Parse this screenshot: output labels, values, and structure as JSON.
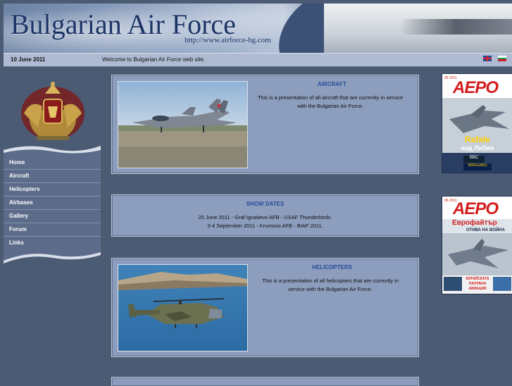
{
  "header": {
    "title": "Bulgarian Air Force",
    "url": "http://www.airforce-bg.com"
  },
  "datebar": {
    "date": "10 June 2011",
    "welcome": "Welcome to Bulgarian Air Force web site."
  },
  "flags": [
    {
      "icon": "uk-flag-icon"
    },
    {
      "icon": "bulgaria-flag-icon"
    }
  ],
  "nav": {
    "items": [
      {
        "label": "Home"
      },
      {
        "label": "Aircraft"
      },
      {
        "label": "Helicopters"
      },
      {
        "label": "Airbases"
      },
      {
        "label": "Gallery"
      },
      {
        "label": "Forum"
      },
      {
        "label": "Links"
      }
    ]
  },
  "panels": {
    "aircraft": {
      "title": "AIRCRAFT",
      "text_line1": "This is a presentation of all aircraft that are currently in service",
      "text_line2": "with the Bulgarian Air Force."
    },
    "show_dates": {
      "title": "SHOW DATES",
      "line1": "25 June 2011 - Graf Ignatievo AFB - USAF Thunderbirds.",
      "line2": "3-4 September 2011 - Krumovo AFB - BIAF 2011."
    },
    "helicopters": {
      "title": "HELICOPTERS",
      "text_line1": "This is a presentation of all helicopters that are currently in",
      "text_line2": "service with the Bulgarian Air Force."
    }
  },
  "magazines": [
    {
      "issue": "05 2011",
      "brand": "АЕРО",
      "headline1": "Rafale",
      "headline2": "над Либия",
      "strip1": "BBC",
      "strip2": "WIKILEAKS"
    },
    {
      "issue": "06 2011",
      "brand": "АЕРО",
      "headline1": "Еврофайтър",
      "headline2": "ОТИВА НА ВОЙНА",
      "strip1": "КИТАЙСКАТА ПАЛУБНА АВИАЦИЯ"
    }
  ],
  "colors": {
    "page_bg": "#4b5b74",
    "panel_bg": "#8c9dbd",
    "title_blue": "#264d98",
    "nav_bg": "#5b6b89",
    "magazine_red": "#d31d1d"
  }
}
